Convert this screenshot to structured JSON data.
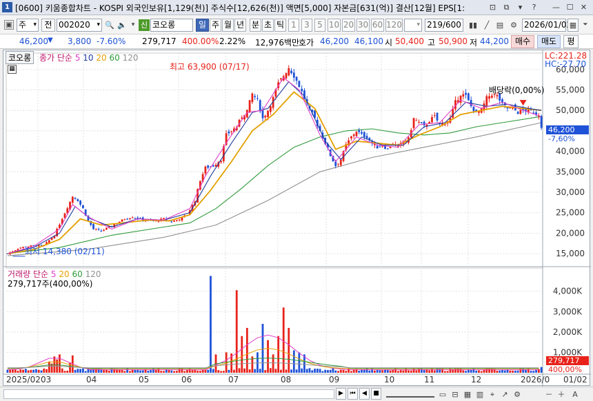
{
  "window": {
    "number": "1",
    "title": "[0600] 키움종합차트 - KOSPI 외국인보유[1,129(천)] 주식수[12,626(천)] 액면[5,000] 자본금[631(억)] 결산[12월] EPS[1:",
    "controls": [
      "⊡",
      "⧉",
      "▾",
      "?",
      "—",
      "☐",
      "✕"
    ]
  },
  "toolbar": {
    "period_unit": "주",
    "prev_label": "전",
    "stock_code": "002020",
    "new_badge": "신",
    "stock_name": "코오롱",
    "periods": [
      "일",
      "주",
      "월",
      "년",
      "분",
      "초",
      "틱"
    ],
    "active_period": "일",
    "intervals": [
      "1",
      "3",
      "5",
      "10",
      "20",
      "30",
      "60",
      "120"
    ],
    "count_display": "219/600",
    "date": "2026/01/02"
  },
  "quote": {
    "price": "46,200",
    "change": "3,800",
    "change_pct": "-7.60%",
    "volume": "279,717",
    "volume_ratio": "400.00%",
    "turnover": "2.22%",
    "amount": "12,976백만",
    "hoga_label": "호가",
    "bid": "46,200",
    "ask": "46,100",
    "open_label": "시",
    "open": "50,400",
    "high_label": "고",
    "high": "50,900",
    "low_label": "저",
    "low": "44,200",
    "buy_button": "매수",
    "sell_button": "매도",
    "eval_button": "평"
  },
  "legend": {
    "stock_tab": "코오롱",
    "price_ma_label": "종가 단순",
    "ma_periods": [
      "5",
      "10",
      "20",
      "60",
      "120"
    ],
    "volume_label": "거래량",
    "volume_ma_label": "단순",
    "volume_value": "279,717주(400,00%)"
  },
  "annotations": {
    "lc": "LC:221.28",
    "hc": "HC:-27.70",
    "high_note": "최고 63,900 (07/17)",
    "low_note": "최저 14,380 (02/11)",
    "dividend_note": "배당락(0,00%)",
    "price_tag": "46,200",
    "price_tag_pct": "-7,60%",
    "vol_tag": "279,717",
    "vol_tag_pct": "400,00%"
  },
  "colors": {
    "up": "#e8221a",
    "down": "#1f52d8",
    "ma5": "#e040c8",
    "ma10": "#1e3a9c",
    "ma20": "#e4a000",
    "ma60": "#2f9a3a",
    "ma120": "#909090"
  },
  "chart_data": {
    "type": "candlestick",
    "x_ticks": [
      "2025/02",
      "03",
      "04",
      "05",
      "06",
      "07",
      "08",
      "09",
      "10",
      "11",
      "12",
      "2026/0",
      "01/02"
    ],
    "price_axis": [
      "60,000",
      "55,000",
      "50,000",
      "45,000",
      "40,000",
      "35,000",
      "30,000",
      "25,000",
      "20,000",
      "15,000"
    ],
    "price_ylim": [
      12500,
      63000
    ],
    "volume_axis": [
      "4,000K",
      "3,000K",
      "2,000K",
      "1,000K"
    ],
    "volume_ylim": [
      0,
      4800000
    ],
    "close_path": [
      [
        0,
        15000
      ],
      [
        5,
        16500
      ],
      [
        10,
        17000
      ],
      [
        14,
        17000
      ],
      [
        18,
        19500
      ],
      [
        22,
        25000
      ],
      [
        25,
        29000
      ],
      [
        27,
        28000
      ],
      [
        29,
        26000
      ],
      [
        31,
        23000
      ],
      [
        33,
        21000
      ],
      [
        36,
        20500
      ],
      [
        39,
        21500
      ],
      [
        42,
        22500
      ],
      [
        45,
        23500
      ],
      [
        48,
        24000
      ],
      [
        51,
        23500
      ],
      [
        54,
        23000
      ],
      [
        57,
        23000
      ],
      [
        60,
        23500
      ],
      [
        63,
        22800
      ],
      [
        66,
        23500
      ],
      [
        69,
        24500
      ],
      [
        72,
        28000
      ],
      [
        74,
        33000
      ],
      [
        76,
        36000
      ],
      [
        79,
        36500
      ],
      [
        82,
        38000
      ],
      [
        84,
        44000
      ],
      [
        86,
        45000
      ],
      [
        88,
        46000
      ],
      [
        90,
        48500
      ],
      [
        92,
        50000
      ],
      [
        94,
        54000
      ],
      [
        96,
        52500
      ],
      [
        98,
        48000
      ],
      [
        100,
        50000
      ],
      [
        102,
        53000
      ],
      [
        104,
        56500
      ],
      [
        106,
        58500
      ],
      [
        108,
        60500
      ],
      [
        110,
        58500
      ],
      [
        112,
        56000
      ],
      [
        114,
        53000
      ],
      [
        116,
        50000
      ],
      [
        118,
        48000
      ],
      [
        120,
        45000
      ],
      [
        122,
        42000
      ],
      [
        124,
        39000
      ],
      [
        126,
        36500
      ],
      [
        128,
        38000
      ],
      [
        130,
        41500
      ],
      [
        132,
        43500
      ],
      [
        134,
        45000
      ],
      [
        136,
        44000
      ],
      [
        138,
        43500
      ],
      [
        140,
        42000
      ],
      [
        142,
        41000
      ],
      [
        144,
        41500
      ],
      [
        146,
        40500
      ],
      [
        148,
        42000
      ],
      [
        150,
        41000
      ],
      [
        152,
        42500
      ],
      [
        154,
        43000
      ],
      [
        156,
        48000
      ],
      [
        158,
        47000
      ],
      [
        160,
        46000
      ],
      [
        162,
        47500
      ],
      [
        164,
        48500
      ],
      [
        166,
        46500
      ],
      [
        168,
        47000
      ],
      [
        170,
        48000
      ],
      [
        172,
        52000
      ],
      [
        174,
        54000
      ],
      [
        176,
        53500
      ],
      [
        178,
        51000
      ],
      [
        180,
        49500
      ],
      [
        182,
        50000
      ],
      [
        184,
        53000
      ],
      [
        186,
        54000
      ],
      [
        188,
        53500
      ],
      [
        190,
        51500
      ],
      [
        192,
        50500
      ],
      [
        194,
        50500
      ],
      [
        196,
        49500
      ],
      [
        198,
        50000
      ],
      [
        200,
        50000
      ],
      [
        202,
        49500
      ],
      [
        204,
        49000
      ],
      [
        205,
        46200
      ]
    ],
    "ma_paths": {
      "ma5": [
        [
          0,
          15000
        ],
        [
          10,
          16800
        ],
        [
          20,
          21000
        ],
        [
          25,
          27000
        ],
        [
          31,
          24000
        ],
        [
          40,
          21000
        ],
        [
          50,
          23500
        ],
        [
          60,
          23200
        ],
        [
          70,
          26000
        ],
        [
          76,
          34000
        ],
        [
          85,
          43000
        ],
        [
          92,
          49500
        ],
        [
          98,
          50000
        ],
        [
          106,
          58000
        ],
        [
          112,
          55000
        ],
        [
          120,
          44000
        ],
        [
          126,
          37500
        ],
        [
          134,
          43500
        ],
        [
          142,
          41500
        ],
        [
          150,
          41000
        ],
        [
          158,
          46500
        ],
        [
          166,
          47000
        ],
        [
          174,
          52500
        ],
        [
          182,
          50500
        ],
        [
          190,
          52000
        ],
        [
          198,
          50000
        ],
        [
          205,
          48500
        ]
      ],
      "ma10": [
        [
          0,
          15000
        ],
        [
          10,
          16500
        ],
        [
          20,
          20000
        ],
        [
          26,
          26500
        ],
        [
          32,
          23500
        ],
        [
          40,
          21500
        ],
        [
          50,
          23500
        ],
        [
          60,
          23200
        ],
        [
          70,
          25000
        ],
        [
          78,
          34000
        ],
        [
          86,
          42000
        ],
        [
          94,
          49500
        ],
        [
          100,
          50500
        ],
        [
          108,
          57000
        ],
        [
          114,
          53500
        ],
        [
          122,
          42500
        ],
        [
          128,
          38000
        ],
        [
          136,
          43500
        ],
        [
          144,
          41500
        ],
        [
          152,
          41500
        ],
        [
          160,
          46000
        ],
        [
          168,
          47000
        ],
        [
          176,
          52000
        ],
        [
          184,
          51000
        ],
        [
          192,
          51500
        ],
        [
          200,
          50500
        ],
        [
          205,
          50000
        ]
      ],
      "ma20": [
        [
          0,
          15000
        ],
        [
          10,
          16000
        ],
        [
          20,
          18500
        ],
        [
          28,
          23500
        ],
        [
          36,
          22000
        ],
        [
          44,
          22500
        ],
        [
          54,
          23200
        ],
        [
          62,
          23000
        ],
        [
          70,
          24500
        ],
        [
          78,
          30500
        ],
        [
          86,
          37500
        ],
        [
          94,
          45000
        ],
        [
          102,
          49000
        ],
        [
          110,
          54500
        ],
        [
          118,
          50500
        ],
        [
          126,
          40500
        ],
        [
          134,
          42500
        ],
        [
          142,
          42000
        ],
        [
          150,
          41500
        ],
        [
          158,
          44000
        ],
        [
          166,
          46000
        ],
        [
          174,
          49000
        ],
        [
          182,
          50000
        ],
        [
          190,
          51000
        ],
        [
          198,
          50500
        ],
        [
          205,
          50000
        ]
      ],
      "ma60": [
        [
          0,
          15000
        ],
        [
          20,
          16500
        ],
        [
          40,
          19500
        ],
        [
          60,
          21500
        ],
        [
          70,
          22500
        ],
        [
          80,
          26000
        ],
        [
          90,
          31000
        ],
        [
          100,
          36500
        ],
        [
          110,
          41000
        ],
        [
          120,
          43500
        ],
        [
          130,
          45000
        ],
        [
          140,
          45500
        ],
        [
          150,
          44500
        ],
        [
          160,
          44000
        ],
        [
          170,
          44500
        ],
        [
          180,
          46000
        ],
        [
          190,
          47000
        ],
        [
          205,
          48500
        ]
      ],
      "ma120": [
        [
          0,
          14500
        ],
        [
          30,
          16000
        ],
        [
          60,
          19000
        ],
        [
          80,
          22000
        ],
        [
          100,
          28000
        ],
        [
          120,
          35000
        ],
        [
          140,
          38500
        ],
        [
          160,
          41000
        ],
        [
          180,
          43500
        ],
        [
          205,
          47000
        ]
      ]
    },
    "ohlc_count": 206,
    "high": {
      "value": 63900,
      "date": "07/17"
    },
    "low": {
      "value": 14380,
      "date": "02/11"
    },
    "last_volume": 279717
  },
  "bottom": {
    "nav": [
      "▶",
      "⏮",
      "◀",
      "■"
    ],
    "zoom": [
      "－",
      "＋",
      "A"
    ]
  }
}
